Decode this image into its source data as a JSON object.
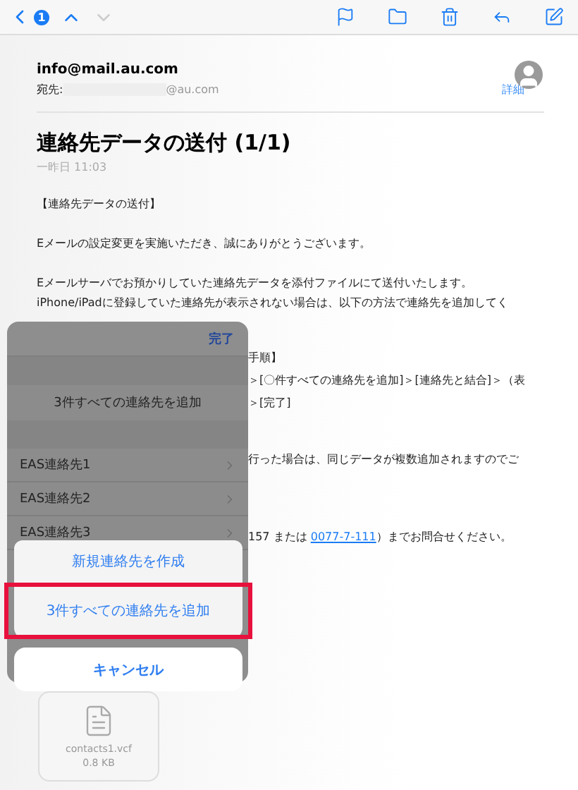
{
  "toolbar": {
    "back_badge": "1",
    "nav": [
      {
        "kind": "up",
        "disabled": false
      },
      {
        "kind": "down",
        "disabled": true
      }
    ],
    "actions": [
      {
        "kind": "flag"
      },
      {
        "kind": "folder"
      },
      {
        "kind": "trash"
      },
      {
        "kind": "reply"
      },
      {
        "kind": "compose"
      }
    ]
  },
  "header": {
    "from": "info@mail.au.com",
    "to_label": "宛先:",
    "to_domain": "@au.com",
    "details": "詳細"
  },
  "subject": "連絡先データの送付 (1/1)",
  "date": "一昨日 11:03",
  "body": [
    {
      "kind": "para",
      "text": "【連絡先データの送付】"
    },
    {
      "kind": "para",
      "text": "Eメールの設定変更を実施いただき、誠にありがとうございます。"
    },
    {
      "kind": "para",
      "text": "Eメールサーバでお預かりしていた連絡先データを添付ファイルにて送付いたします。\niPhone/iPadに登録していた連絡先が表示されない場合は、以下の方法で連絡先を追加してく"
    }
  ],
  "fragments": [
    {
      "kind": "line",
      "text": "手順】"
    },
    {
      "kind": "line",
      "text": "＞[〇件すべての連絡先を追加]＞[連絡先と結合]＞（表"
    },
    {
      "kind": "line",
      "text": "＞[完了]"
    },
    {
      "kind": "gap"
    },
    {
      "kind": "line",
      "text": "行った場合は、同じデータが複数追加されますのでご"
    },
    {
      "kind": "gap"
    },
    {
      "kind": "phone",
      "before": "157 または ",
      "link": "0077-7-111",
      "after": "）までお問合せください。"
    }
  ],
  "attachment": {
    "name": "contacts1.vcf",
    "size": "0.8 KB"
  },
  "popover": {
    "done": "完了",
    "add_all": "3件すべての連絡先を追加",
    "contacts": [
      "EAS連絡先1",
      "EAS連絡先2",
      "EAS連絡先3"
    ]
  },
  "action_sheet": [
    {
      "label": "新規連絡先を作成",
      "kind": "action",
      "highlighted": false
    },
    {
      "label": "3件すべての連絡先を追加",
      "kind": "action",
      "highlighted": true
    },
    {
      "label": "キャンセル",
      "kind": "cancel",
      "highlighted": false
    }
  ]
}
